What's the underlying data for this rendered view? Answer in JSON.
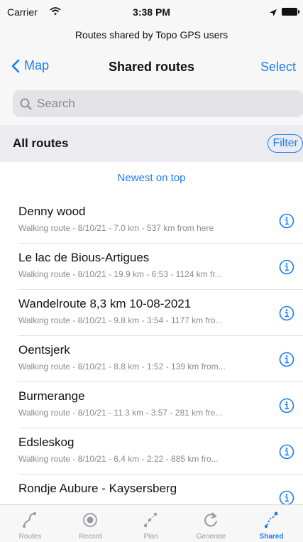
{
  "status_bar": {
    "carrier": "Carrier",
    "time": "3:38 PM"
  },
  "banner": {
    "text": "Routes shared by Topo GPS users"
  },
  "navbar": {
    "back_label": "Map",
    "title": "Shared routes",
    "select_label": "Select"
  },
  "search": {
    "placeholder": "Search"
  },
  "section": {
    "title": "All routes",
    "filter_label": "Filter"
  },
  "sort": {
    "label": "Newest on top"
  },
  "routes": [
    {
      "title": "Denny wood",
      "subtitle": "Walking route - 8/10/21 - 7.0 km - 537 km from here"
    },
    {
      "title": "Le lac de Bious-Artigues",
      "subtitle": "Walking route - 8/10/21 - 19.9 km - 6:53 - 1124 km fr..."
    },
    {
      "title": "Wandelroute 8,3 km 10-08-2021",
      "subtitle": "Walking route - 8/10/21 - 9.8 km - 3:54 - 1177 km fro..."
    },
    {
      "title": "Oentsjerk",
      "subtitle": "Walking route - 8/10/21 - 8.8 km - 1:52 - 139 km from..."
    },
    {
      "title": "Burmerange",
      "subtitle": "Walking route - 8/10/21 - 11.3 km - 3:57 - 281 km fre..."
    },
    {
      "title": "Edsleskog",
      "subtitle": "Walking route - 8/10/21 - 6.4 km - 2:22 - 885 km fro..."
    },
    {
      "title": "Rondje Aubure - Kaysersberg",
      "subtitle": ""
    }
  ],
  "tabs": [
    {
      "label": "Routes",
      "icon": "routes-icon"
    },
    {
      "label": "Record",
      "icon": "record-icon"
    },
    {
      "label": "Plan",
      "icon": "plan-icon"
    },
    {
      "label": "Generate",
      "icon": "generate-icon"
    },
    {
      "label": "Shared",
      "icon": "shared-icon",
      "active": true
    }
  ],
  "colors": {
    "accent": "#1a7cf5",
    "bar_background": "#f7f7f7",
    "section_background": "#ececf0",
    "secondary_text": "#8a8a8f"
  }
}
